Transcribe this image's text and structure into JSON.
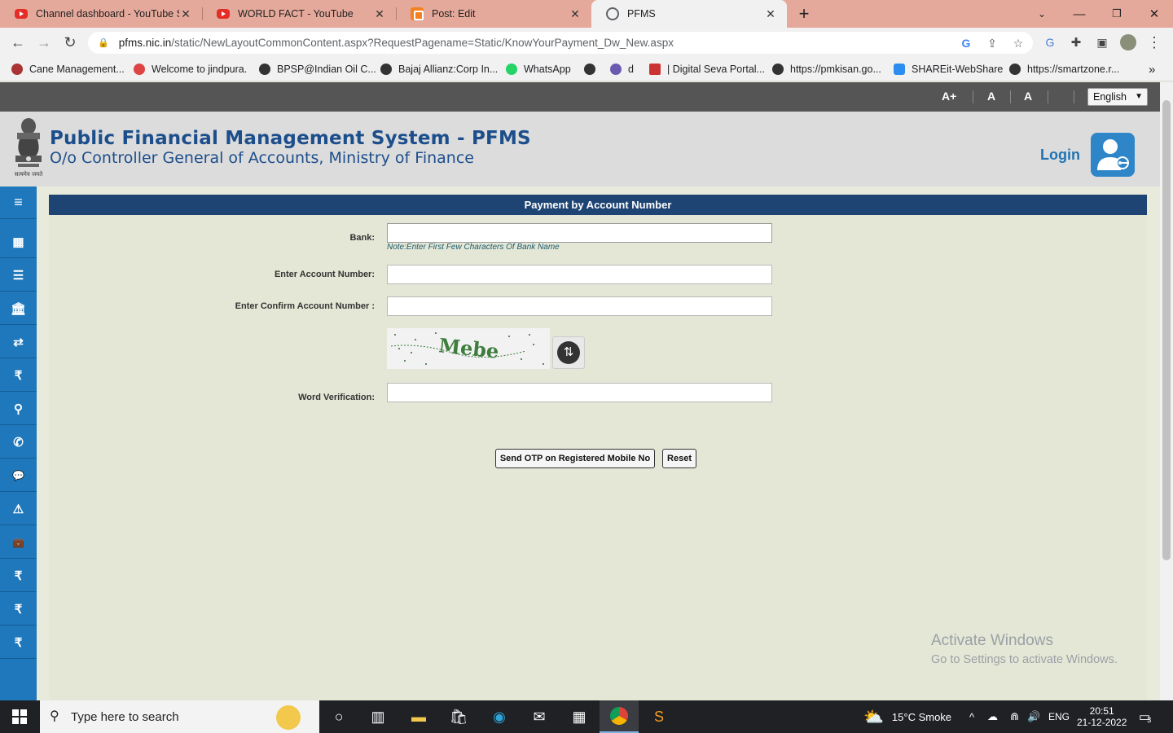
{
  "browser": {
    "tabs": [
      {
        "title": "Channel dashboard - YouTube St",
        "icon": "youtube-icon",
        "active": false
      },
      {
        "title": "WORLD FACT - YouTube",
        "icon": "youtube-icon",
        "active": false
      },
      {
        "title": "Post: Edit",
        "icon": "blogger-icon",
        "active": false
      },
      {
        "title": "PFMS",
        "icon": "globe-icon",
        "active": true
      }
    ],
    "new_tab": "+",
    "url_host": "pfms.nic.in",
    "url_path": "/static/NewLayoutCommonContent.aspx?RequestPagename=Static/KnowYourPayment_Dw_New.aspx",
    "bookmarks": [
      "Cane Management...",
      "Welcome to jindpura.",
      "BPSP@Indian Oil C...",
      "Bajaj Allianz:Corp In...",
      "WhatsApp",
      "",
      "d",
      "| Digital Seva Portal...",
      "https://pmkisan.go...",
      "SHAREit-WebShare",
      "https://smartzone.r..."
    ],
    "bookmarks_more": "»"
  },
  "pfms": {
    "font_sizes": [
      "A+",
      "A",
      "A"
    ],
    "language": "English",
    "title": "Public Financial Management System - PFMS",
    "subtitle": "O/o Controller General of Accounts, Ministry of Finance",
    "emblem_caption": "सत्यमेव जयते",
    "login": "Login",
    "sidebar_icons": [
      "menu-icon",
      "building-icon",
      "list-icon",
      "bank-icon",
      "transfer-icon",
      "rupee-icon",
      "location-icon",
      "phone-icon",
      "chat-icon",
      "warning-icon",
      "briefcase-icon",
      "rupee-icon",
      "rupee-icon",
      "rupee-icon"
    ],
    "sidebar_glyphs": [
      "≡",
      "▦",
      "☰",
      "🏛",
      "⇄",
      "₹",
      "⚲",
      "✆",
      "💬",
      "⚠",
      "💼",
      "₹",
      "₹",
      "₹"
    ],
    "form": {
      "heading": "Payment by Account Number",
      "bank_label": "Bank:",
      "bank_value": "",
      "bank_note": "Note:Enter First Few Characters Of Bank Name",
      "account_label": "Enter Account Number:",
      "confirm_label": "Enter Confirm Account Number :",
      "captcha_text": "Mebe",
      "word_label": "Word Verification:",
      "send_otp": "Send OTP on Registered Mobile No",
      "reset": "Reset"
    },
    "watermark_title": "Activate Windows",
    "watermark_sub": "Go to Settings to activate Windows."
  },
  "taskbar": {
    "search_placeholder": "Type here to search",
    "weather": "15°C  Smoke",
    "language": "ENG",
    "time": "20:51",
    "date": "21-12-2022",
    "notifications": "3"
  }
}
